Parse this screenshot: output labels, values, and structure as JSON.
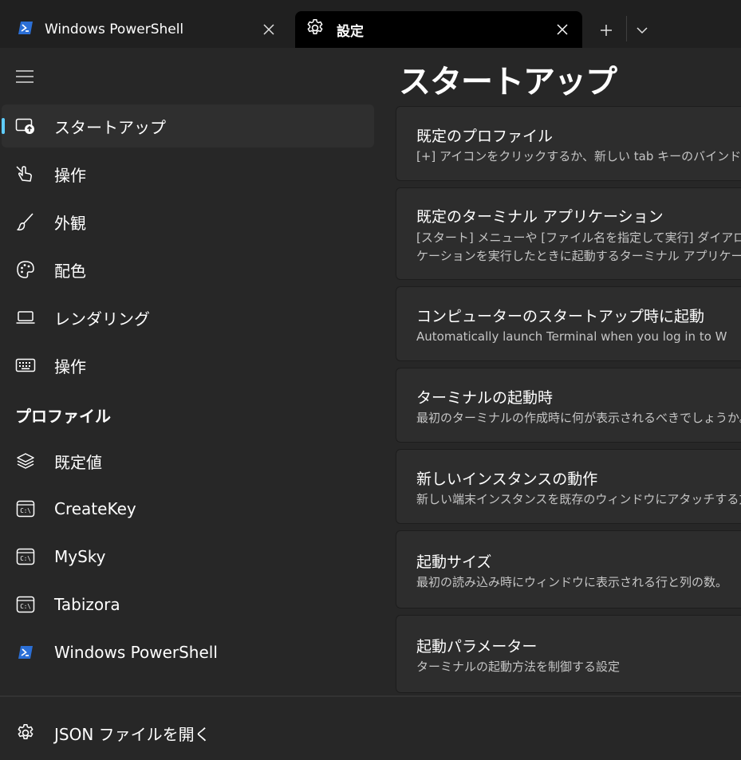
{
  "tabs": [
    {
      "title": "Windows PowerShell",
      "icon": "powershell-icon",
      "active": false
    },
    {
      "title": "設定",
      "icon": "gear-icon",
      "active": true
    }
  ],
  "colors": {
    "accent": "#60cdff",
    "powershell": "#2b6fd6"
  },
  "sidebar": {
    "items": [
      {
        "label": "スタートアップ",
        "icon": "startup-icon"
      },
      {
        "label": "操作",
        "icon": "pointer-hand-icon"
      },
      {
        "label": "外観",
        "icon": "brush-icon"
      },
      {
        "label": "配色",
        "icon": "palette-icon"
      },
      {
        "label": "レンダリング",
        "icon": "laptop-icon"
      },
      {
        "label": "操作",
        "icon": "keyboard-icon"
      }
    ],
    "profiles_heading": "プロファイル",
    "profiles": [
      {
        "label": "既定値",
        "icon": "layers-icon"
      },
      {
        "label": "CreateKey",
        "icon": "terminal-icon"
      },
      {
        "label": "MySky",
        "icon": "terminal-icon"
      },
      {
        "label": "Tabizora",
        "icon": "terminal-icon"
      },
      {
        "label": "Windows PowerShell",
        "icon": "powershell-icon"
      }
    ],
    "open_json": "JSON ファイルを開く"
  },
  "page": {
    "title": "スタートアップ",
    "cards": [
      {
        "title": "既定のプロファイル",
        "desc": [
          "[+] アイコンをクリックするか、新しい tab キーのバインドを入"
        ]
      },
      {
        "title": "既定のターミナル アプリケーション",
        "desc": [
          "[スタート] メニューや [ファイル名を指定して実行] ダイアログな",
          "ケーションを実行したときに起動するターミナル アプリケーショ"
        ]
      },
      {
        "title": "コンピューターのスタートアップ時に起動",
        "desc": [
          "Automatically launch Terminal when you log in to W"
        ]
      },
      {
        "title": "ターミナルの起動時",
        "desc": [
          "最初のターミナルの作成時に何が表示されるべきでしょうか。"
        ]
      },
      {
        "title": "新しいインスタンスの動作",
        "desc": [
          "新しい端末インスタンスを既存のウィンドウにアタッチする方"
        ]
      },
      {
        "title": "起動サイズ",
        "desc": [
          "最初の読み込み時にウィンドウに表示される行と列の数。"
        ]
      },
      {
        "title": "起動パラメーター",
        "desc": [
          "ターミナルの起動方法を制御する設定"
        ]
      }
    ]
  }
}
